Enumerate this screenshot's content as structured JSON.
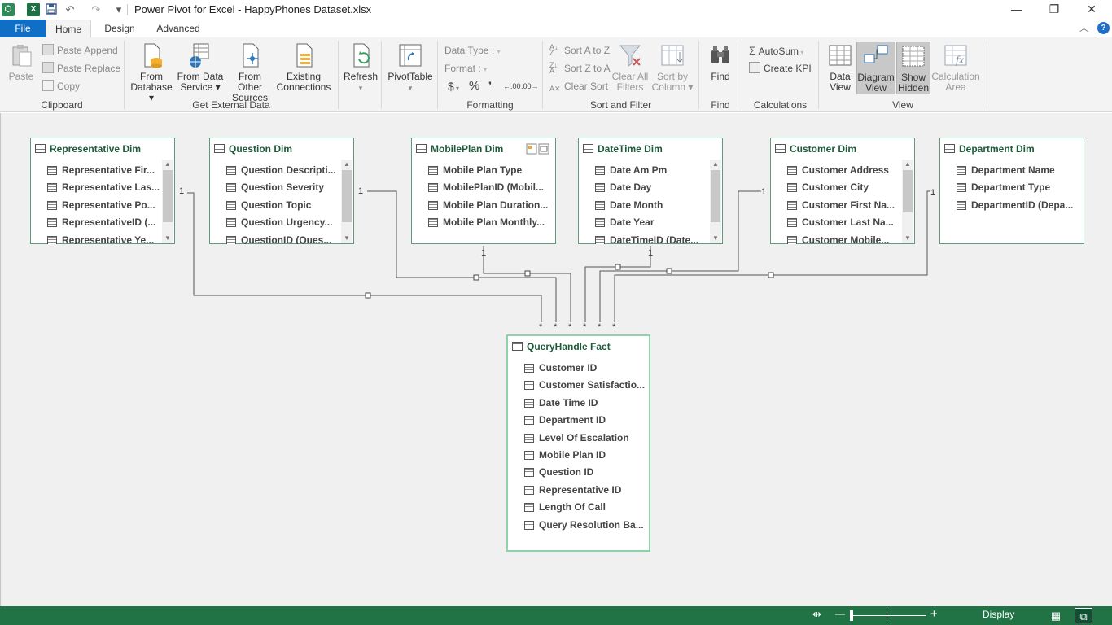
{
  "window": {
    "title": "Power Pivot for Excel - HappyPhones Dataset.xlsx",
    "minimize": "—",
    "maximize": "❐",
    "close": "✕"
  },
  "tabs": {
    "file": "File",
    "items": [
      "Home",
      "Design",
      "Advanced"
    ],
    "active": "Home"
  },
  "ribbon": {
    "clipboard": {
      "label": "Clipboard",
      "paste": "Paste",
      "paste_append": "Paste Append",
      "paste_replace": "Paste Replace",
      "copy": "Copy"
    },
    "external": {
      "label": "Get External Data",
      "from_database": [
        "From",
        "Database ▾"
      ],
      "from_data_service": [
        "From Data",
        "Service ▾"
      ],
      "from_other_sources": [
        "From Other",
        "Sources"
      ],
      "existing_connections": [
        "Existing",
        "Connections"
      ]
    },
    "refresh": {
      "label": "Refresh",
      "caret": "▾"
    },
    "pivottable": {
      "label": "PivotTable",
      "caret": "▾"
    },
    "formatting": {
      "label": "Formatting",
      "data_type": "Data Type :",
      "format": "Format :",
      "currency": "$",
      "percent": "%",
      "comma": "❜",
      "inc_decimal": ".00",
      "dec_decimal": ".00"
    },
    "sort_filter": {
      "label": "Sort and Filter",
      "sort_az": "Sort A to Z",
      "sort_za": "Sort Z to A",
      "clear_sort": "Clear Sort",
      "clear_all_filters": [
        "Clear All",
        "Filters"
      ],
      "sort_by_column": [
        "Sort by",
        "Column ▾"
      ]
    },
    "find": {
      "label": "Find",
      "button": "Find"
    },
    "calculations": {
      "label": "Calculations",
      "autosum": "AutoSum",
      "create_kpi": "Create KPI"
    },
    "view": {
      "label": "View",
      "data_view": [
        "Data",
        "View"
      ],
      "diagram_view": [
        "Diagram",
        "View"
      ],
      "show_hidden": [
        "Show",
        "Hidden"
      ],
      "calculation_area": [
        "Calculation",
        "Area"
      ]
    }
  },
  "diagram": {
    "tables": [
      {
        "title": "Representative Dim",
        "columns": [
          "Representative Fir...",
          "Representative Las...",
          "Representative Po...",
          "RepresentativeID (...",
          "Representative Ye..."
        ]
      },
      {
        "title": "Question Dim",
        "columns": [
          "Question Descripti...",
          "Question Severity",
          "Question Topic",
          "Question Urgency...",
          "QuestionID (Ques..."
        ]
      },
      {
        "title": "MobilePlan Dim",
        "columns": [
          "Mobile Plan Type",
          "MobilePlanID (Mobil...",
          "Mobile Plan Duration...",
          "Mobile Plan Monthly..."
        ]
      },
      {
        "title": "DateTime Dim",
        "columns": [
          "Date Am Pm",
          "Date Day",
          "Date Month",
          "Date Year",
          "DateTimeID (Date..."
        ]
      },
      {
        "title": "Customer Dim",
        "columns": [
          "Customer Address",
          "Customer City",
          "Customer First Na...",
          "Customer Last Na...",
          "Customer Mobile..."
        ]
      },
      {
        "title": "Department Dim",
        "columns": [
          "Department Name",
          "Department Type",
          "DepartmentID (Depa..."
        ]
      }
    ],
    "fact": {
      "title": "QueryHandle Fact",
      "columns": [
        "Customer ID",
        "Customer Satisfactio...",
        "Date Time ID",
        "Department ID",
        "Level Of Escalation",
        "Mobile Plan ID",
        "Question ID",
        "Representative ID",
        "Length Of Call",
        "Query Resolution Ba..."
      ]
    },
    "one_label": "1",
    "many_label": "*"
  },
  "statusbar": {
    "display": "Display",
    "zoom_in": "+",
    "zoom_out": "—",
    "zoom_level": 0.0
  }
}
